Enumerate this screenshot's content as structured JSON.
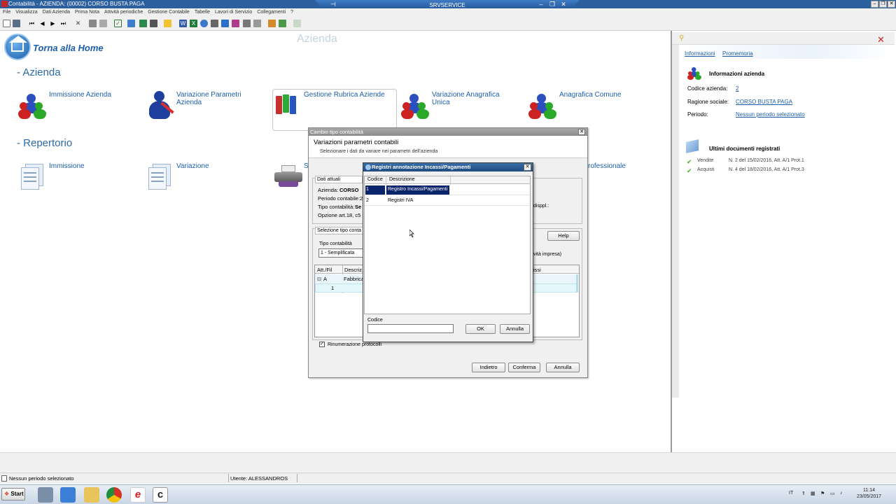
{
  "window": {
    "title": "Contabilità - AZIENDA: (00002) CORSO BUSTA PAGA",
    "rdp_title": "SRVSERVICE"
  },
  "menu": [
    "File",
    "Visualizza",
    "Dati Azienda",
    "Prima Nota",
    "Attività periodiche",
    "Gestione Contabile",
    "Tabelle",
    "Lavori di Servizio",
    "Collegamenti",
    "?"
  ],
  "home": {
    "link": "Torna alla Home",
    "watermark": "Azienda"
  },
  "sections": {
    "azienda": "- Azienda",
    "repertorio": "- Repertorio"
  },
  "azienda_tiles": [
    {
      "label": "Immissione Azienda"
    },
    {
      "label": "Variazione Parametri Azienda"
    },
    {
      "label": "Gestione Rubrica Aziende"
    },
    {
      "label": "Variazione Anagrafica Unica"
    },
    {
      "label": "Anagrafica Comune"
    }
  ],
  "repertorio_tiles": [
    {
      "label": "Immissione"
    },
    {
      "label": "Variazione"
    },
    {
      "label": "S"
    },
    {
      "label": "rofessionale"
    }
  ],
  "right_panel": {
    "tabs": [
      "Informazioni",
      "Promemoria"
    ],
    "info_title": "Informazioni azienda",
    "codice_label": "Codice azienda:",
    "codice_value": "2",
    "ragione_label": "Ragione sociale:",
    "ragione_value": "CORSO BUSTA PAGA",
    "periodo_label": "Periodo:",
    "periodo_value": "Nessun periodo selezionato",
    "docs_title": "Ultimi documenti registrati",
    "docs": [
      {
        "label": "Vendite",
        "value": "N. 2 del 15/02/2016, Att. A/1 Prot.1"
      },
      {
        "label": "Acquisti",
        "value": "N. 4 del 18/02/2016, Att. A/1 Prot.3"
      }
    ]
  },
  "dialog1": {
    "title": "Cambio tipo contabilità",
    "heading": "Variazioni parametri contabili",
    "subheading": "Selezionare i dati da variare nei parametri dell'azienda",
    "group1_title": "Dati attuali",
    "azienda_label": "Azienda:",
    "azienda_value": "CORSO",
    "periodo_label": "Periodo contabile:",
    "periodo_value": "2",
    "tipo_label": "Tipo contabilità:",
    "tipo_value": "Se",
    "opzione_label": "Opzione art.18, c5 D",
    "right_fragment": "disppl.:",
    "group2_title": "Selezione tipo conta",
    "help_button": "Help",
    "tipo_contab_label": "Tipo contabilità",
    "tipo_contab_value": "1 - Semplificata",
    "impresa_fragment": "vità impresa)",
    "grid_headers": [
      "Att./Fil",
      "Descriz",
      "issi"
    ],
    "grid_rows": [
      {
        "att": "A",
        "desc": "Fabbrica"
      },
      {
        "att": "1",
        "desc": ""
      }
    ],
    "rinumerazione": "Rinumerazione protocolli",
    "buttons": {
      "back": "Indietro",
      "confirm": "Conferma",
      "cancel": "Annulla"
    }
  },
  "dialog2": {
    "title": "Registri annotazione Incassi/Pagamenti",
    "headers": [
      "Codice",
      "Descrizione"
    ],
    "rows": [
      {
        "codice": "1",
        "descrizione": "Registro Incassi/Pagamenti"
      },
      {
        "codice": "2",
        "descrizione": "Registri IVA"
      }
    ],
    "codice_label": "Codice",
    "codice_value": "",
    "buttons": {
      "ok": "OK",
      "cancel": "Annulla"
    }
  },
  "statusbar": {
    "periodo": "Nessun periodo selezionato",
    "utente": "Utente: ALESSANDROS"
  },
  "taskbar": {
    "start": "Start",
    "lang": "IT",
    "time": "11:14",
    "date": "23/05/2017"
  }
}
